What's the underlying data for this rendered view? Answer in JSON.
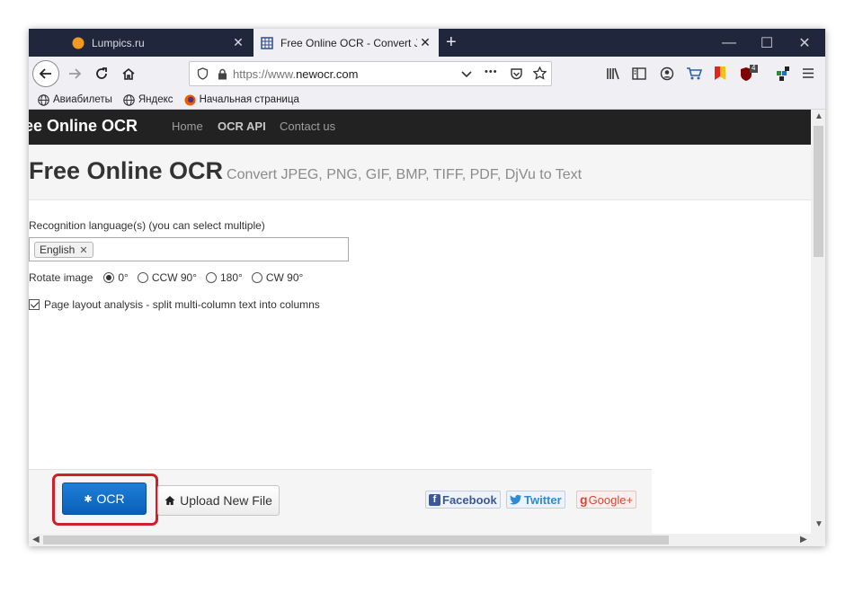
{
  "browser": {
    "tabs": [
      {
        "title": "Lumpics.ru",
        "close": "✕",
        "favicon": "orange-circle-icon"
      },
      {
        "title": "Free Online OCR - Convert JPEG",
        "close": "✕",
        "favicon": "grid-icon"
      }
    ],
    "new_tab": "+",
    "window_controls": {
      "minimize": "—",
      "maximize": "☐",
      "close": "✕"
    },
    "url": {
      "scheme": "https://www.",
      "host": "newocr.com",
      "more": "•••"
    },
    "bookmarks": [
      {
        "label": "Авиабилеты"
      },
      {
        "label": "Яндекс"
      },
      {
        "label": "Начальная страница"
      }
    ],
    "badge_count": "4"
  },
  "site": {
    "brand": "ee Online OCR",
    "nav": [
      {
        "label": "Home"
      },
      {
        "label": "OCR API"
      },
      {
        "label": "Contact us"
      }
    ],
    "hero_title": "Free Online OCR",
    "hero_subtitle": "Convert JPEG, PNG, GIF, BMP, TIFF, PDF, DjVu to Text",
    "lang_label": "Recognition language(s) (you can select multiple)",
    "selected_language": "English",
    "chip_remove": "✕",
    "rotate_label": "Rotate image",
    "rotate_options": [
      {
        "label": "0°",
        "selected": true
      },
      {
        "label": "CCW 90°",
        "selected": false
      },
      {
        "label": "180°",
        "selected": false
      },
      {
        "label": "CW 90°",
        "selected": false
      }
    ],
    "layout_label": "Page layout analysis - split multi-column text into columns",
    "ocr_button": "OCR",
    "upload_button": "Upload New File",
    "share": {
      "facebook": "Facebook",
      "twitter": "Twitter",
      "google": "Google+",
      "google_prefix": "g"
    }
  },
  "colors": {
    "tabbar": "#20263b",
    "sitenav": "#222222",
    "ocr_button": "#0a5fb8",
    "highlight": "#d11f27"
  }
}
